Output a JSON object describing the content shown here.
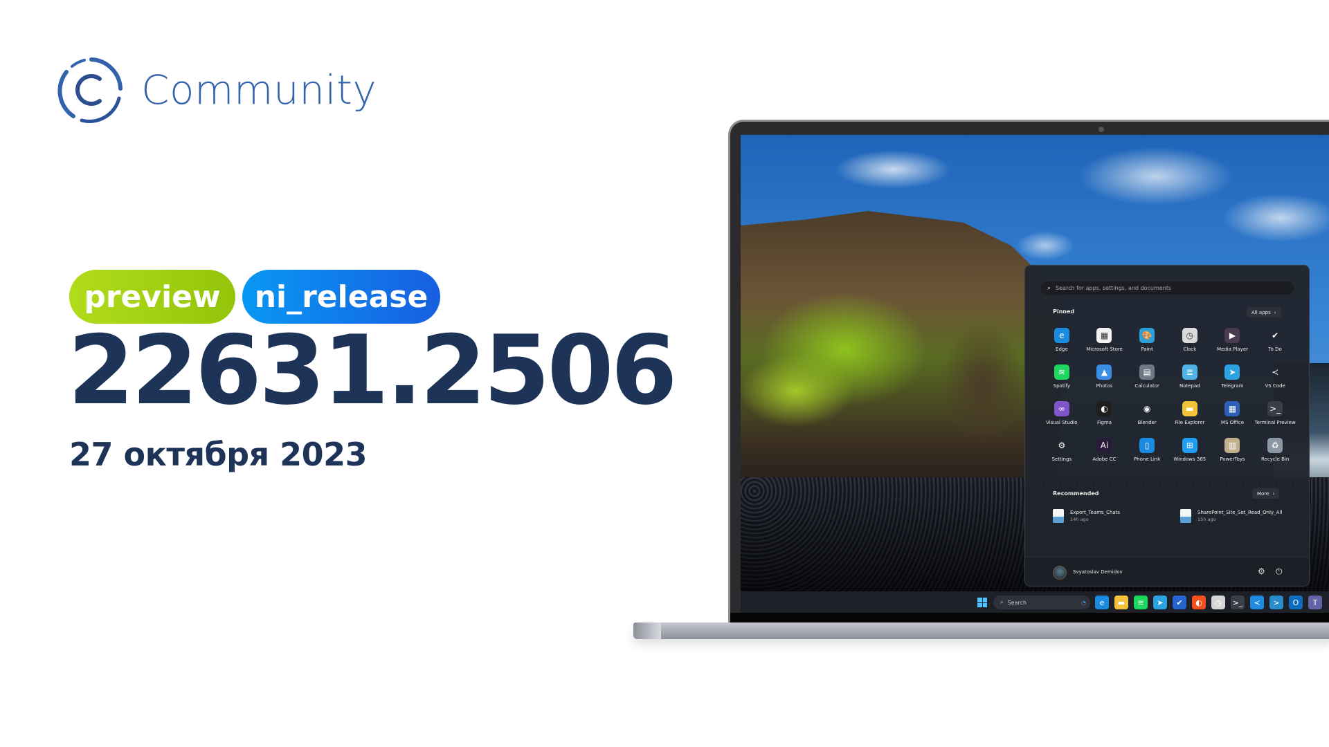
{
  "brand": {
    "name": "Community",
    "logo_icon": "community-c-logo-icon",
    "color": "#3463ad"
  },
  "badges": [
    {
      "label": "preview",
      "color_start": "#b1dc1c",
      "color_end": "#93c409"
    },
    {
      "label": "ni_release",
      "color_start": "#0898f4",
      "color_end": "#175fe0"
    }
  ],
  "build": {
    "number": "22631.2506",
    "date": "27 октября 2023",
    "color": "#1d3358"
  },
  "start_menu": {
    "search_placeholder": "Search for apps, settings, and documents",
    "pinned_label": "Pinned",
    "all_apps_label": "All apps",
    "pinned_apps": [
      {
        "label": "Edge",
        "icon": "edge-icon",
        "glyph": "e",
        "bg": "#1b8be0"
      },
      {
        "label": "Microsoft Store",
        "icon": "store-icon",
        "glyph": "▦",
        "bg": "#f2f2f2"
      },
      {
        "label": "Paint",
        "icon": "paint-icon",
        "glyph": "🎨",
        "bg": "#2a9fd8"
      },
      {
        "label": "Clock",
        "icon": "clock-icon",
        "glyph": "◷",
        "bg": "#dadada"
      },
      {
        "label": "Media Player",
        "icon": "media-player-icon",
        "glyph": "▶",
        "bg": "#4a3b4f"
      },
      {
        "label": "To Do",
        "icon": "todo-icon",
        "glyph": "✔",
        "bg": "transparent"
      },
      {
        "label": "Spotify",
        "icon": "spotify-icon",
        "glyph": "≋",
        "bg": "#1ed760"
      },
      {
        "label": "Photos",
        "icon": "photos-icon",
        "glyph": "▲",
        "bg": "#3a8ee6"
      },
      {
        "label": "Calculator",
        "icon": "calculator-icon",
        "glyph": "▤",
        "bg": "#6f7885"
      },
      {
        "label": "Notepad",
        "icon": "notepad-icon",
        "glyph": "≣",
        "bg": "#4fb3e8"
      },
      {
        "label": "Telegram",
        "icon": "telegram-icon",
        "glyph": "➤",
        "bg": "#2aa3e0"
      },
      {
        "label": "VS Code",
        "icon": "vscode-icon",
        "glyph": "≺",
        "bg": "transparent"
      },
      {
        "label": "Visual Studio",
        "icon": "visual-studio-icon",
        "glyph": "∞",
        "bg": "#7f56c9"
      },
      {
        "label": "Figma",
        "icon": "figma-icon",
        "glyph": "◐",
        "bg": "#1e1e1e"
      },
      {
        "label": "Blender",
        "icon": "blender-icon",
        "glyph": "◉",
        "bg": "transparent"
      },
      {
        "label": "File Explorer",
        "icon": "file-explorer-icon",
        "glyph": "▬",
        "bg": "#f4c23a"
      },
      {
        "label": "MS Office",
        "icon": "ms-office-icon",
        "glyph": "▦",
        "bg": "#2b5fb8"
      },
      {
        "label": "Terminal Preview",
        "icon": "terminal-icon",
        "glyph": ">_",
        "bg": "#3a3f47"
      },
      {
        "label": "Settings",
        "icon": "settings-icon",
        "glyph": "⚙",
        "bg": "transparent"
      },
      {
        "label": "Adobe CC",
        "icon": "adobe-cc-icon",
        "glyph": "Ai",
        "bg": "#2a1a3a"
      },
      {
        "label": "Phone Link",
        "icon": "phone-link-icon",
        "glyph": "▯",
        "bg": "#1a8ae0"
      },
      {
        "label": "Windows 365",
        "icon": "windows-365-icon",
        "glyph": "⊞",
        "bg": "#1f9ef0"
      },
      {
        "label": "PowerToys",
        "icon": "powertoys-icon",
        "glyph": "▥",
        "bg": "#c2b08a"
      },
      {
        "label": "Recycle Bin",
        "icon": "recycle-bin-icon",
        "glyph": "♻",
        "bg": "#8a98a5"
      }
    ],
    "recommended_label": "Recommended",
    "more_label": "More",
    "recommended": [
      {
        "name": "Export_Teams_Chats",
        "time": "14h ago"
      },
      {
        "name": "SharePoint_Site_Set_Read_Only_All",
        "time": "15h ago"
      }
    ],
    "user_name": "Svyatoslav Demidov"
  },
  "taskbar": {
    "search_label": "Search",
    "apps": [
      {
        "icon": "edge-canary-icon",
        "glyph": "e",
        "bg": "#1b8be0"
      },
      {
        "icon": "file-explorer-icon",
        "glyph": "▬",
        "bg": "#f4c23a"
      },
      {
        "icon": "spotify-icon",
        "glyph": "≋",
        "bg": "#1ed760"
      },
      {
        "icon": "telegram-icon",
        "glyph": "➤",
        "bg": "#2aa3e0"
      },
      {
        "icon": "todo-icon",
        "glyph": "✔",
        "bg": "#2564cf"
      },
      {
        "icon": "figma-icon",
        "glyph": "◐",
        "bg": "#f24e1e"
      },
      {
        "icon": "clock-icon",
        "glyph": "◷",
        "bg": "#d5d5d5"
      },
      {
        "icon": "terminal-icon",
        "glyph": ">_",
        "bg": "#3a3f47"
      },
      {
        "icon": "vscode-icon",
        "glyph": "≺",
        "bg": "#1f8ae0"
      },
      {
        "icon": "powershell-icon",
        "glyph": ">",
        "bg": "#2b8ccd"
      },
      {
        "icon": "outlook-icon",
        "glyph": "O",
        "bg": "#0f6cbd"
      },
      {
        "icon": "teams-icon",
        "glyph": "T",
        "bg": "#6264a7"
      }
    ]
  }
}
